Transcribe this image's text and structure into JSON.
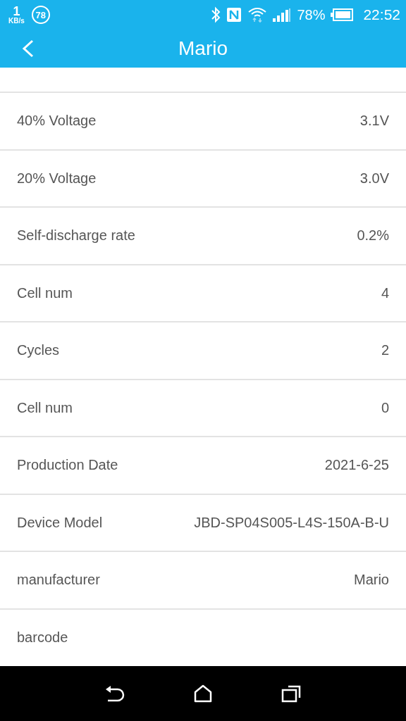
{
  "status_bar": {
    "speed_value": "1",
    "speed_unit": "KB/s",
    "notification_count": "78",
    "battery_percent": "78%",
    "time": "22:52"
  },
  "header": {
    "title": "Mario"
  },
  "rows": [
    {
      "label": "40% Voltage",
      "value": "3.1V"
    },
    {
      "label": "20% Voltage",
      "value": "3.0V"
    },
    {
      "label": "Self-discharge rate",
      "value": "0.2%"
    },
    {
      "label": "Cell num",
      "value": "4"
    },
    {
      "label": "Cycles",
      "value": "2"
    },
    {
      "label": "Cell num",
      "value": "0"
    },
    {
      "label": "Production Date",
      "value": "2021-6-25"
    },
    {
      "label": "Device Model",
      "value": "JBD-SP04S005-L4S-150A-B-U"
    },
    {
      "label": "manufacturer",
      "value": "Mario"
    },
    {
      "label": "barcode"
    }
  ]
}
